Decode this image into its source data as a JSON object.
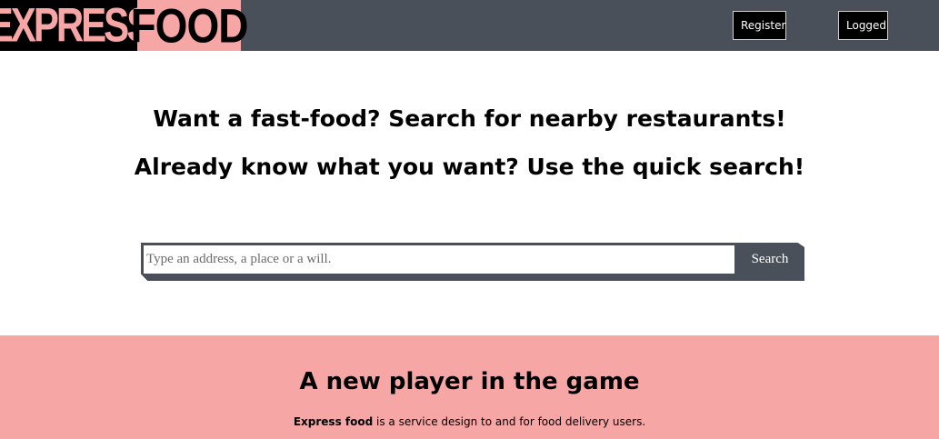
{
  "navbar": {
    "logo_express": "EXPRESS",
    "logo_food": "FOOD",
    "register_label": "Register",
    "logged_label": "Logged"
  },
  "hero": {
    "line1": "Want a fast-food? Search for nearby restaurants!",
    "line2": "Already know what you want? Use the quick search!"
  },
  "search": {
    "placeholder": "Type an address, a place or a will.",
    "value": "",
    "button_label": "Search"
  },
  "about": {
    "title": "A new player in the game",
    "text_bold": "Express food",
    "text_rest": " is a service design to and for food delivery users."
  },
  "colors": {
    "navbar": "#4a5059",
    "accent_pink": "#f7a6a6",
    "black": "#000000"
  }
}
